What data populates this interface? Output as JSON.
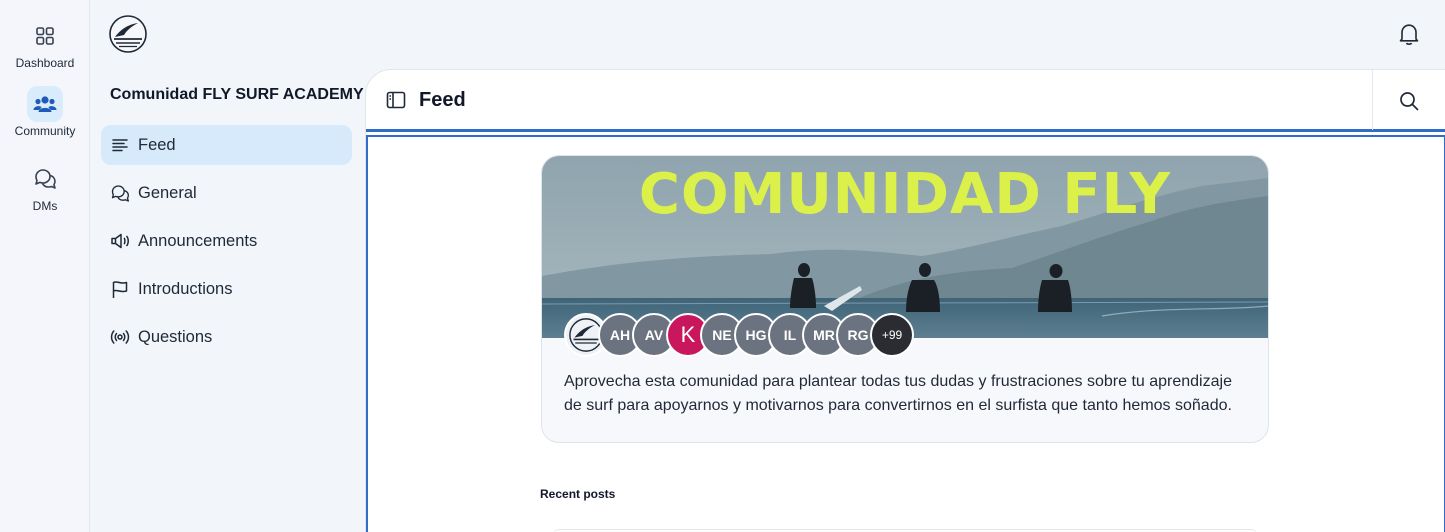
{
  "rail": {
    "items": [
      {
        "label": "Dashboard",
        "icon": "grid-icon",
        "active": false
      },
      {
        "label": "Community",
        "icon": "users-icon",
        "active": true
      },
      {
        "label": "DMs",
        "icon": "chat-bubbles-icon",
        "active": false
      }
    ]
  },
  "sidebar": {
    "title": "Comunidad FLY SURF ACADEMY",
    "items": [
      {
        "label": "Feed",
        "icon": "lines-icon",
        "active": true
      },
      {
        "label": "General",
        "icon": "chat-bubbles-icon",
        "active": false
      },
      {
        "label": "Announcements",
        "icon": "megaphone-icon",
        "active": false
      },
      {
        "label": "Introductions",
        "icon": "flag-icon",
        "active": false
      },
      {
        "label": "Questions",
        "icon": "broadcast-icon",
        "active": false
      }
    ]
  },
  "header": {
    "title": "Feed"
  },
  "card": {
    "banner_title": "COMUNIDAD FLY",
    "avatars": [
      "AH",
      "AV",
      "K",
      "NE",
      "HG",
      "IL",
      "MR",
      "RG"
    ],
    "more_count": "+99",
    "description": "Aprovecha esta comunidad para plantear todas tus dudas y frustraciones sobre tu aprendizaje de surf para apoyarnos y motivarnos para convertirnos en el surfista que tanto hemos soñado."
  },
  "recent_posts": {
    "label": "Recent posts"
  },
  "colors": {
    "accent": "#2f6ccb",
    "active_bg": "#d6eafb",
    "banner_text": "#dcf04a",
    "avatar_k": "#c8175c"
  }
}
